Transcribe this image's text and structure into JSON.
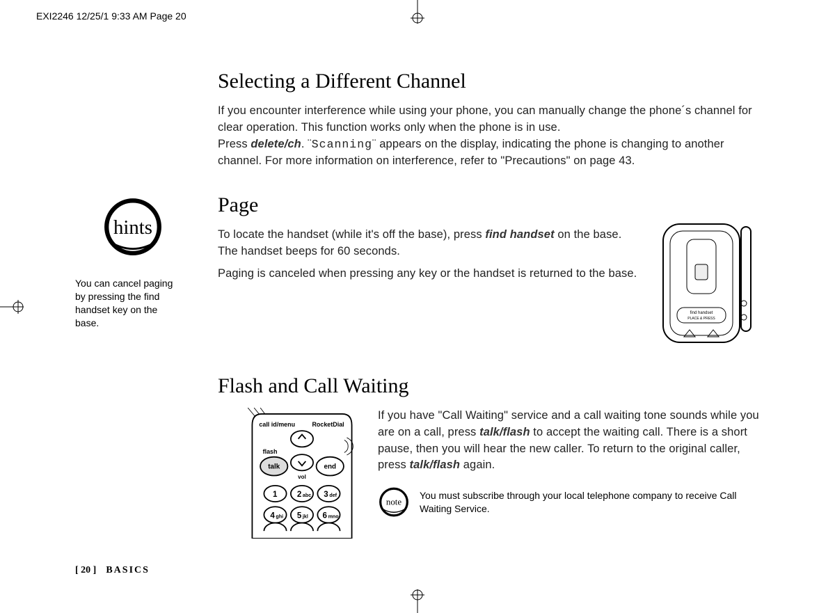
{
  "header": "EXI2246  12/25/1 9:33 AM  Page 20",
  "sidebar": {
    "hints_label": "hints",
    "hints_body": "You can cancel paging by pressing the find handset key on the base."
  },
  "section1": {
    "title": "Selecting a Different Channel",
    "p1a": "If you encounter interference while using your phone, you can manually change the phone´s channel for clear operation. This function works only when the phone is in use.",
    "p1b_pre": "Press ",
    "key1": "delete/ch",
    "p1b_mid": ". ¨",
    "lcd": "Scanning",
    "p1b_post": "¨ appears on the display, indicating the phone is changing to another channel. For more information on interference, refer to \"Precautions\" on page 43."
  },
  "section2": {
    "title": "Page",
    "p_pre": "To locate the handset (while it's off the base), press ",
    "key": "find handset",
    "p_post": " on the base. The handset beeps for 60 seconds.",
    "p2": "Paging is canceled when pressing any key or the handset is returned to the base."
  },
  "section3": {
    "title": "Flash and Call Waiting",
    "p_pre": "If you have \"Call Waiting\" service and a call waiting tone sounds while you are on a call, press ",
    "key1": "talk/flash",
    "p_mid": " to accept the waiting call. There is a short pause, then you will hear the new caller. To return to the original caller, press ",
    "key2": "talk/flash",
    "p_post": " again.",
    "note_label": "note",
    "note_body": "You must subscribe through your local telephone company to receive Call Waiting Service."
  },
  "footer": {
    "page": "[ 20 ]",
    "section": "BASICS"
  },
  "illus": {
    "base_text1": "find handset",
    "base_text2": "PLACE & PRESS",
    "handset_top_left": "call id/menu",
    "handset_top_right": "RocketDial",
    "handset_flash": "flash",
    "handset_talk": "talk",
    "handset_end": "end",
    "handset_vol": "vol",
    "keys": {
      "1": "1",
      "2": "2",
      "2s": "abc",
      "3": "3",
      "3s": "def",
      "4": "4",
      "4s": "ghi",
      "5": "5",
      "5s": "jkl",
      "6": "6",
      "6s": "mno"
    }
  }
}
